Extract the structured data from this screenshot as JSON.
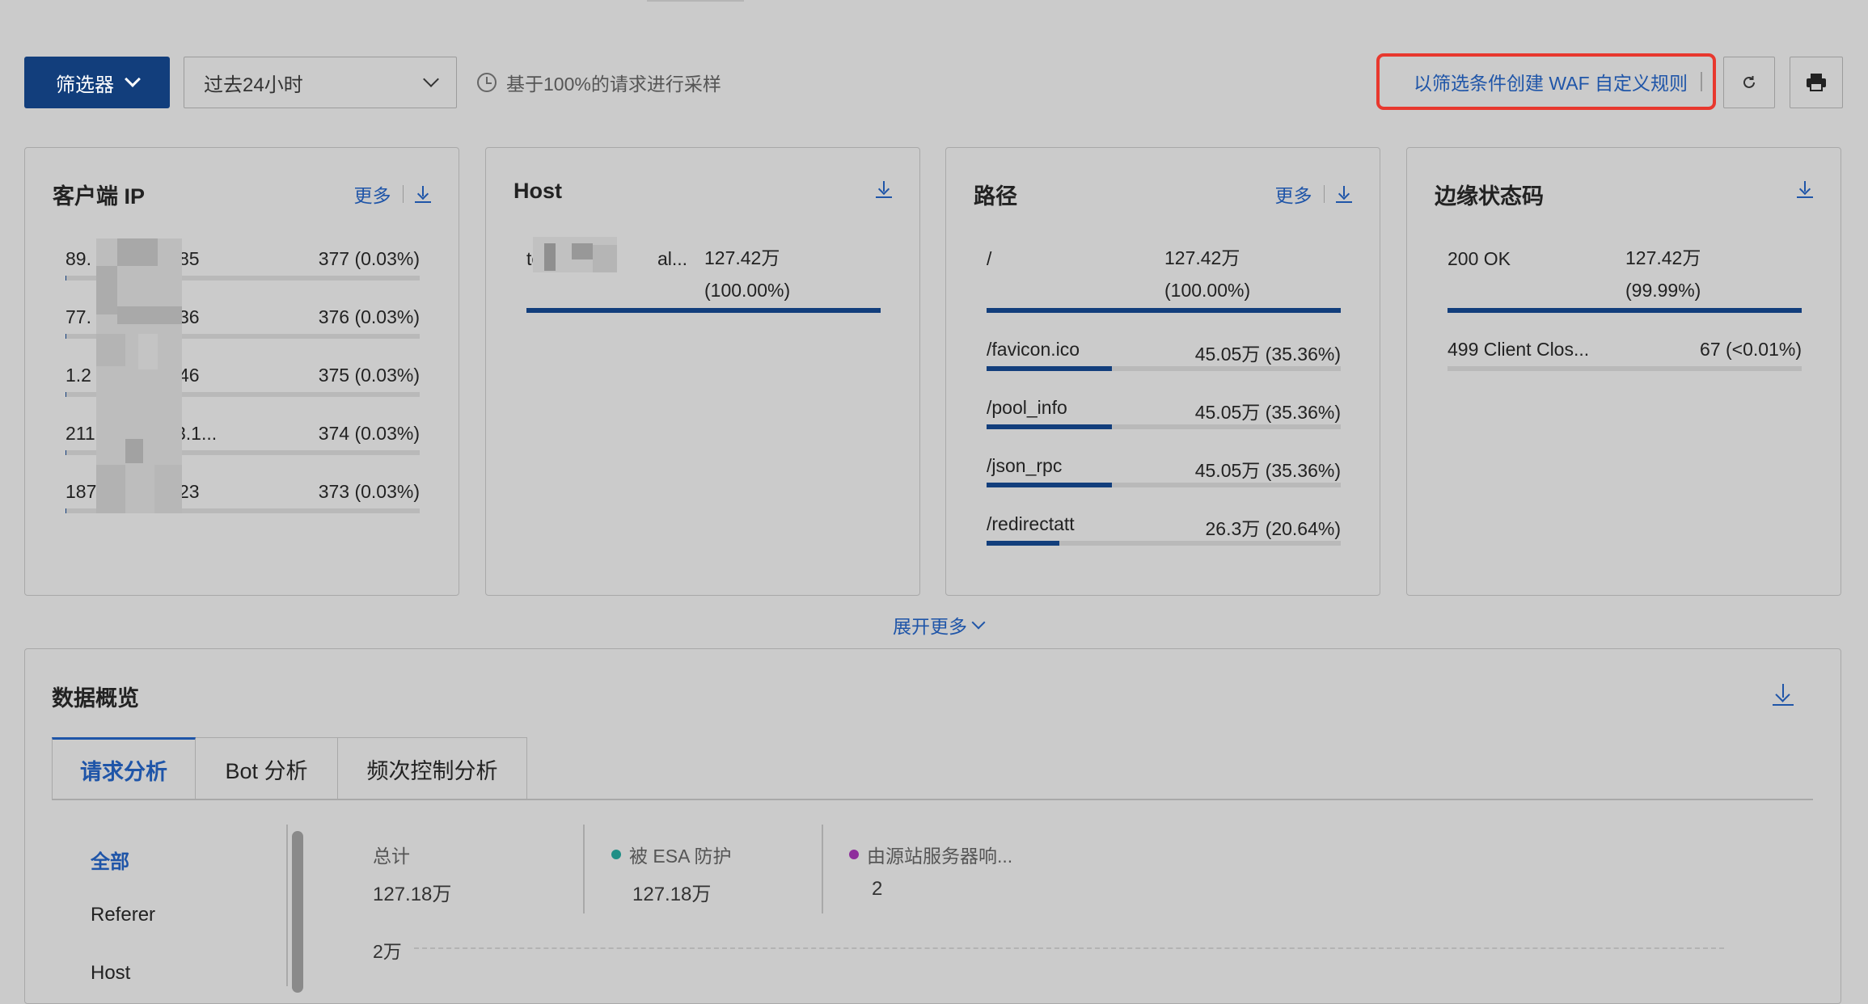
{
  "toolbar": {
    "filter_label": "筛选器",
    "time_range": "过去24小时",
    "sampling_note": "基于100%的请求进行采样",
    "create_waf_rule": "以筛选条件创建 WAF 自定义规则"
  },
  "cards": {
    "client_ip": {
      "title": "客户端 IP",
      "more": "更多",
      "rows": [
        {
          "label_a": "89.",
          "label_b": "85",
          "value": "377 (0.03%)",
          "pct": 0.03
        },
        {
          "label_a": "77.",
          "label_b": "36",
          "value": "376 (0.03%)",
          "pct": 0.03
        },
        {
          "label_a": "1.2",
          "label_b": "46",
          "value": "375 (0.03%)",
          "pct": 0.03
        },
        {
          "label_a": "211",
          "label_b": "3.1...",
          "value": "374 (0.03%)",
          "pct": 0.03
        },
        {
          "label_a": "187",
          "label_b": "23",
          "value": "373 (0.03%)",
          "pct": 0.03
        }
      ]
    },
    "host": {
      "title": "Host",
      "rows": [
        {
          "label_a": "te:",
          "label_b": "al...",
          "value_line1": "127.42万",
          "value_line2": "(100.00%)",
          "pct": 100
        }
      ]
    },
    "path": {
      "title": "路径",
      "more": "更多",
      "rows": [
        {
          "label": "/",
          "value_line1": "127.42万",
          "value_line2": "(100.00%)",
          "pct": 100
        },
        {
          "label": "/favicon.ico",
          "value": "45.05万 (35.36%)",
          "pct": 35.36
        },
        {
          "label": "/pool_info",
          "value": "45.05万 (35.36%)",
          "pct": 35.36
        },
        {
          "label": "/json_rpc",
          "value": "45.05万 (35.36%)",
          "pct": 35.36
        },
        {
          "label": "/redirectatt",
          "value": "26.3万 (20.64%)",
          "pct": 20.64
        }
      ]
    },
    "edge_status": {
      "title": "边缘状态码",
      "rows": [
        {
          "label": "200 OK",
          "value_line1": "127.42万",
          "value_line2": "(99.99%)",
          "pct": 99.99
        },
        {
          "label": "499 Client Clos...",
          "value": "67 (<0.01%)",
          "pct": 0.01
        }
      ]
    }
  },
  "expand_more": "展开更多",
  "overview": {
    "title": "数据概览",
    "tabs": [
      "请求分析",
      "Bot 分析",
      "频次控制分析"
    ],
    "side_items": [
      "全部",
      "Referer",
      "Host"
    ],
    "stats": [
      {
        "label": "总计",
        "value": "127.18万"
      },
      {
        "label": "被 ESA 防护",
        "value": "127.18万",
        "color": "#1f8f86"
      },
      {
        "label": "由源站服务器响...",
        "value": "2",
        "color": "#8e2e9c"
      }
    ],
    "y_tick": "2万"
  },
  "colors": {
    "accent": "#1f55a8",
    "primary_button": "#123e7c",
    "highlight_border": "#e8382e"
  }
}
